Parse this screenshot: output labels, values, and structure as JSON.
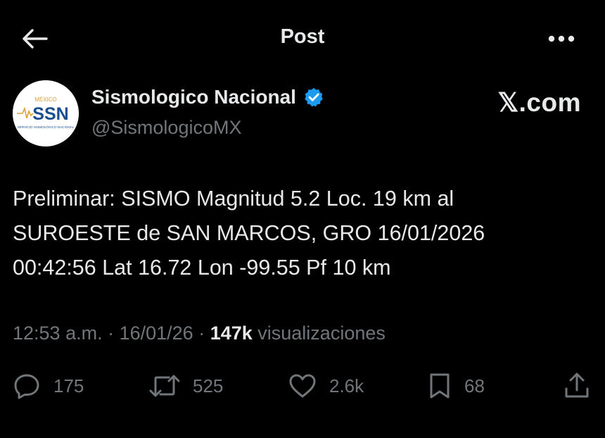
{
  "header": {
    "title": "Post",
    "back_icon": "arrow-left-icon",
    "more_icon": "more-dots-icon"
  },
  "author": {
    "name": "Sismologico Nacional",
    "handle": "@SismologicoMX",
    "verified": true,
    "verified_color": "#1d9bf0",
    "avatar": {
      "logo_text": "SSN",
      "logo_top_text": "MÉXICO",
      "logo_sub_text": "SERVICIO SISMOLÓGICO NACIONAL",
      "logo_color": "#1a4f8f",
      "accent_color": "#d8a23a"
    }
  },
  "source_label": "𝕏.com",
  "post": {
    "lines": [
      "Preliminar: SISMO Magnitud 5.2 Loc. 19 km al",
      "SUROESTE de SAN MARCOS, GRO 16/01/2026",
      "00:42:56 Lat 16.72 Lon -99.55 Pf 10 km"
    ]
  },
  "meta": {
    "time": "12:53 a.m.",
    "separator": " · ",
    "date": "16/01/26",
    "views_count": "147k",
    "views_label": "visualizaciones"
  },
  "actions": {
    "replies": {
      "icon": "reply-icon",
      "count": "175"
    },
    "reposts": {
      "icon": "repost-icon",
      "count": "525"
    },
    "likes": {
      "icon": "heart-icon",
      "count": "2.6k"
    },
    "bookmarks": {
      "icon": "bookmark-icon",
      "count": "68"
    },
    "share": {
      "icon": "share-icon"
    }
  },
  "colors": {
    "background": "#000000",
    "primary_text": "#e7e9ea",
    "secondary_text": "#71767b"
  }
}
